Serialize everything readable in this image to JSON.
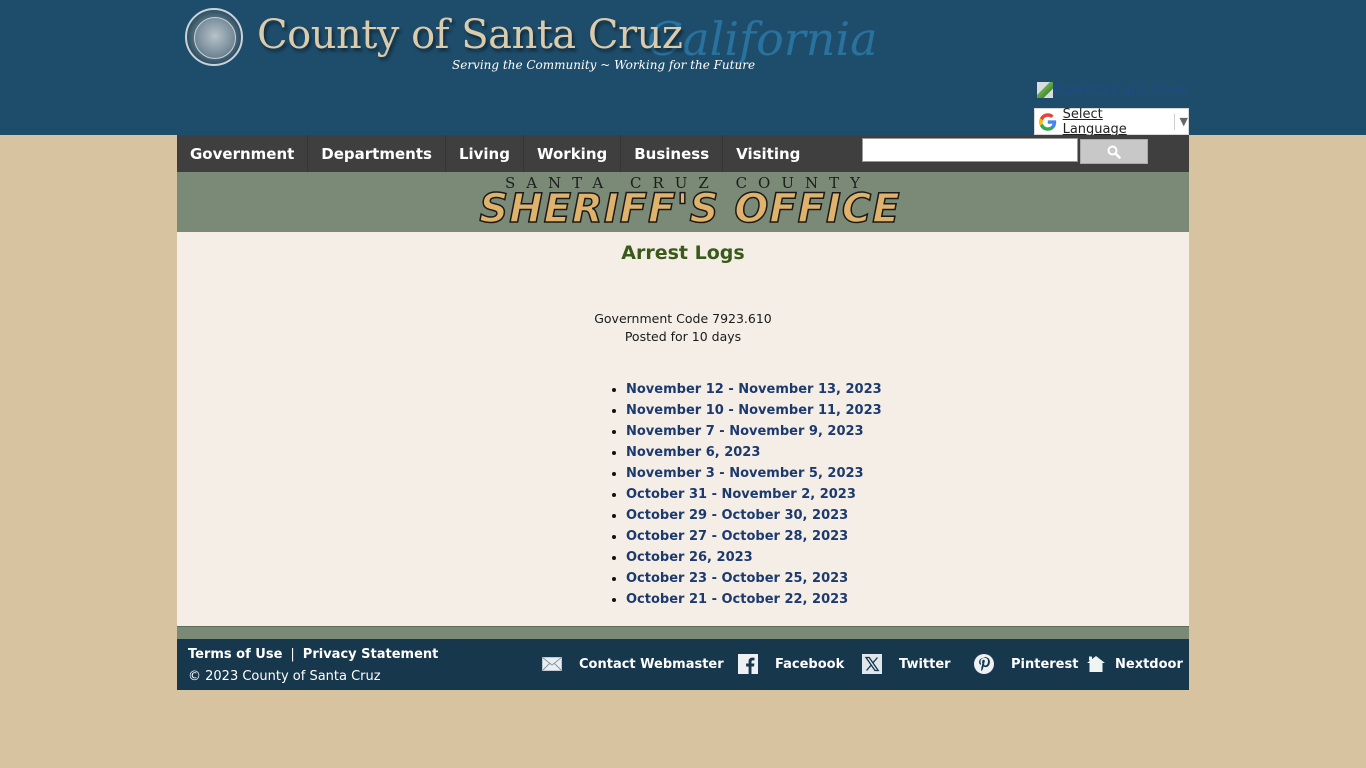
{
  "header": {
    "site_title": "County of Santa Cruz",
    "state_script": "California",
    "tagline": "Serving the Community ~ Working for the Future",
    "bookmark_label": "Bookmark and Share",
    "language_label": "Select Language",
    "language_arrow": "▼"
  },
  "nav": {
    "items": [
      {
        "label": "Government"
      },
      {
        "label": "Departments"
      },
      {
        "label": "Living"
      },
      {
        "label": "Working"
      },
      {
        "label": "Business"
      },
      {
        "label": "Visiting"
      }
    ],
    "search_placeholder": "",
    "search_value": ""
  },
  "banner": {
    "top_line": "SANTA CRUZ COUNTY",
    "main_line": "SHERIFF'S OFFICE"
  },
  "content": {
    "title": "Arrest Logs",
    "gov_code": "Government Code 7923.610",
    "posted": "Posted for 10 days",
    "logs": [
      {
        "label": "November 12 - November 13, 2023"
      },
      {
        "label": "November 10 - November 11, 2023"
      },
      {
        "label": "November 7 - November 9, 2023"
      },
      {
        "label": "November 6, 2023"
      },
      {
        "label": "November 3 - November 5, 2023"
      },
      {
        "label": "October 31 - November 2, 2023"
      },
      {
        "label": "October 29 - October 30, 2023"
      },
      {
        "label": "October 27 - October 28, 2023"
      },
      {
        "label": "October 26, 2023"
      },
      {
        "label": "October 23 - October 25, 2023"
      },
      {
        "label": "October 21 - October 22, 2023"
      }
    ]
  },
  "footer": {
    "terms_label": "Terms of Use",
    "separator": "|",
    "privacy_label": "Privacy Statement",
    "copyright": "© 2023 County of Santa Cruz",
    "social": [
      {
        "label": "Contact Webmaster",
        "icon": "mail-icon"
      },
      {
        "label": "Facebook",
        "icon": "facebook-icon"
      },
      {
        "label": "Twitter",
        "icon": "x-twitter-icon"
      },
      {
        "label": "Pinterest",
        "icon": "pinterest-icon"
      },
      {
        "label": "Nextdoor",
        "icon": "nextdoor-icon"
      }
    ]
  },
  "colors": {
    "header_bg": "#1e4d6b",
    "nav_bg": "#3f3f3f",
    "banner_bg": "#7a8a76",
    "content_bg": "#f4eee6",
    "page_bg": "#d7c3a0",
    "title_green": "#3a5a19",
    "link_blue": "#1d3a6e",
    "footer_bg": "#17374d"
  }
}
